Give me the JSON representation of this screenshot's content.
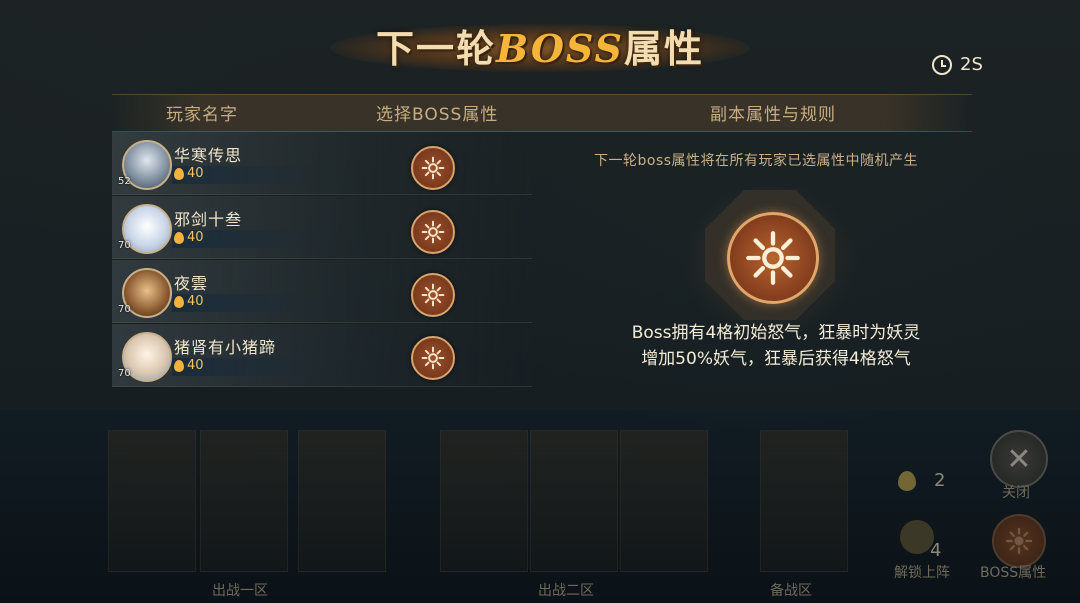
{
  "title": {
    "prefix": "下一轮",
    "accent": "BOSS",
    "suffix": "属性"
  },
  "timer": {
    "value": "2S",
    "icon": "clock-icon"
  },
  "columns": {
    "player_name": "玩家名字",
    "select_boss_attr": "选择BOSS属性",
    "dungeon_rules": "副本属性与规则"
  },
  "players": [
    {
      "name": "华寒传思",
      "level": "52",
      "gold": "40",
      "avatar_color": "#7a8a9a"
    },
    {
      "name": "邪剑十叁",
      "level": "70",
      "gold": "40",
      "avatar_color": "#c9d6e8"
    },
    {
      "name": "夜雲",
      "level": "70",
      "gold": "40",
      "avatar_color": "#8a5a30"
    },
    {
      "name": "猪肾有小猪蹄",
      "level": "70",
      "gold": "40",
      "avatar_color": "#dcc8b0"
    }
  ],
  "rule_hint": "下一轮boss属性将在所有玩家已选属性中随机产生",
  "description": {
    "line1": "Boss拥有4格初始怒气，狂暴时为妖灵",
    "line2": "增加50%妖气，狂暴后获得4格怒气"
  },
  "zones": {
    "zone1": "出战一区",
    "zone2": "出战二区",
    "reserve": "备战区"
  },
  "resources": {
    "gold_count": "2",
    "unlock_count": "4"
  },
  "side_buttons": {
    "close": "关闭",
    "unlock": "解锁上阵",
    "boss_attr": "BOSS属性"
  },
  "colors": {
    "accent_gold": "#f5b43a",
    "sun_button": "#9c4f2a",
    "text_light": "#f4ecd8"
  }
}
